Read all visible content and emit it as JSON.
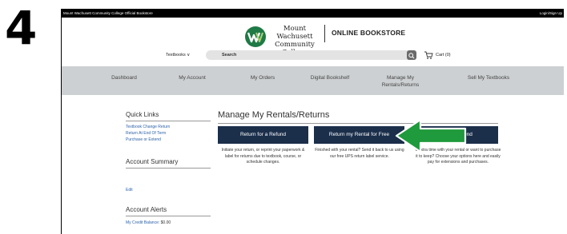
{
  "step_number": "4",
  "topbar": {
    "store_name": "Mount Wachusett Community College Official Bookstore",
    "login": "Login/Sign Up"
  },
  "header": {
    "college_line1": "Mount Wachusett",
    "college_line2": "Community College",
    "online_bookstore": "ONLINE BOOKSTORE",
    "textbooks_menu": "Textbooks ∨",
    "search_placeholder": "Search",
    "cart": "Cart (0)"
  },
  "nav": {
    "items": [
      {
        "label": "Dashboard"
      },
      {
        "label": "My Account"
      },
      {
        "label": "My Orders"
      },
      {
        "label": "Digital Bookshelf"
      },
      {
        "label": "Manage My Rentals/Returns"
      },
      {
        "label": "Sell My Textbooks"
      }
    ]
  },
  "sidebar": {
    "quick_links_title": "Quick Links",
    "quick_links": [
      "Textbook Change Return",
      "Return At End Of Term",
      "Purchase or Extend"
    ],
    "account_summary_title": "Account Summary",
    "edit": "Edit",
    "account_alerts_title": "Account Alerts",
    "credit_label": "My Credit Balance:",
    "credit_value": "$0.00"
  },
  "main": {
    "title": "Manage My Rentals/Returns",
    "buttons": [
      {
        "label": "Return for a Refund",
        "desc": "Initiate your return, or reprint your paperwork & label for returns due to textbook, course, or schedule changes."
      },
      {
        "label": "Return my Rental for Free",
        "desc": "Finished with your rental? Send it back to us using our free UPS return label service."
      },
      {
        "label": "or Extend",
        "desc": "d extra time with your rental or want to purchase it to keep? Choose your options here and easily pay for extensions and purchases."
      }
    ]
  },
  "colors": {
    "button_bg": "#1b2f4b",
    "link": "#2e62a8",
    "nav_bg": "#cdd0d2",
    "arrow": "#1f9a3c",
    "logo_green": "#1f7a45"
  }
}
